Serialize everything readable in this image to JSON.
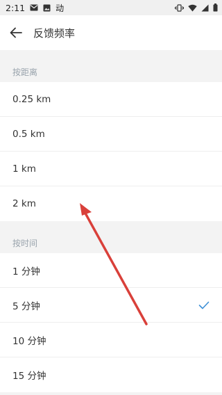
{
  "status_bar": {
    "time": "2:11",
    "left_icons": [
      "mail-icon",
      "image-icon",
      "app-icon"
    ],
    "app_glyph": "动",
    "right_icons": [
      "vibrate-icon",
      "wifi-icon",
      "signal-icon",
      "battery-icon"
    ]
  },
  "app_bar": {
    "back_icon": "back-arrow-icon",
    "title": "反馈频率"
  },
  "sections": {
    "distance": {
      "header": "按距离",
      "items": [
        "0.25 km",
        "0.5 km",
        "1 km",
        "2 km"
      ]
    },
    "time": {
      "header": "按时间",
      "items": [
        "1 分钟",
        "5 分钟",
        "10 分钟",
        "15 分钟"
      ],
      "selected": "5 分钟"
    }
  },
  "colors": {
    "check": "#3d8fd6",
    "arrow": "#d9403a",
    "header_text": "#9aa4ad"
  }
}
